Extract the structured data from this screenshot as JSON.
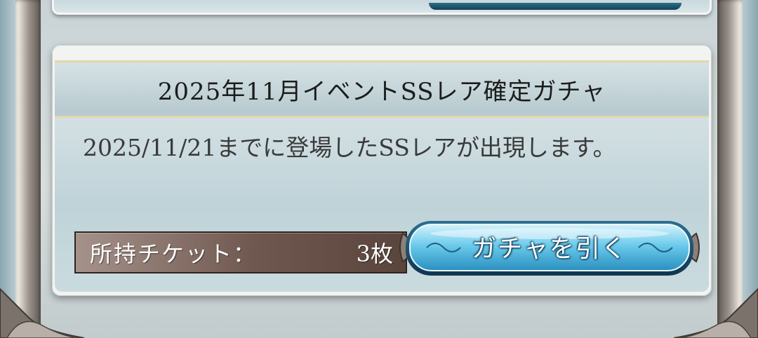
{
  "gacha": {
    "title": "2025年11月イベントSSレア確定ガチャ",
    "description": "2025/11/21までに登場したSSレアが出現します。",
    "ticket": {
      "label": "所持チケット：",
      "count": "3枚"
    },
    "draw_button_label": "ガチャを引く"
  },
  "icons": {
    "frame": "ornate-frame-icon",
    "button_ornament": "swirl-ornament-icon"
  },
  "colors": {
    "card_bg": "#f2f4f2",
    "title_bar": "#c4d5d9",
    "ticket_panel": "#6e574e",
    "button_main": "#5ec6e8",
    "button_border": "#1b4d6b",
    "gold_trim": "#e6d6a8"
  }
}
